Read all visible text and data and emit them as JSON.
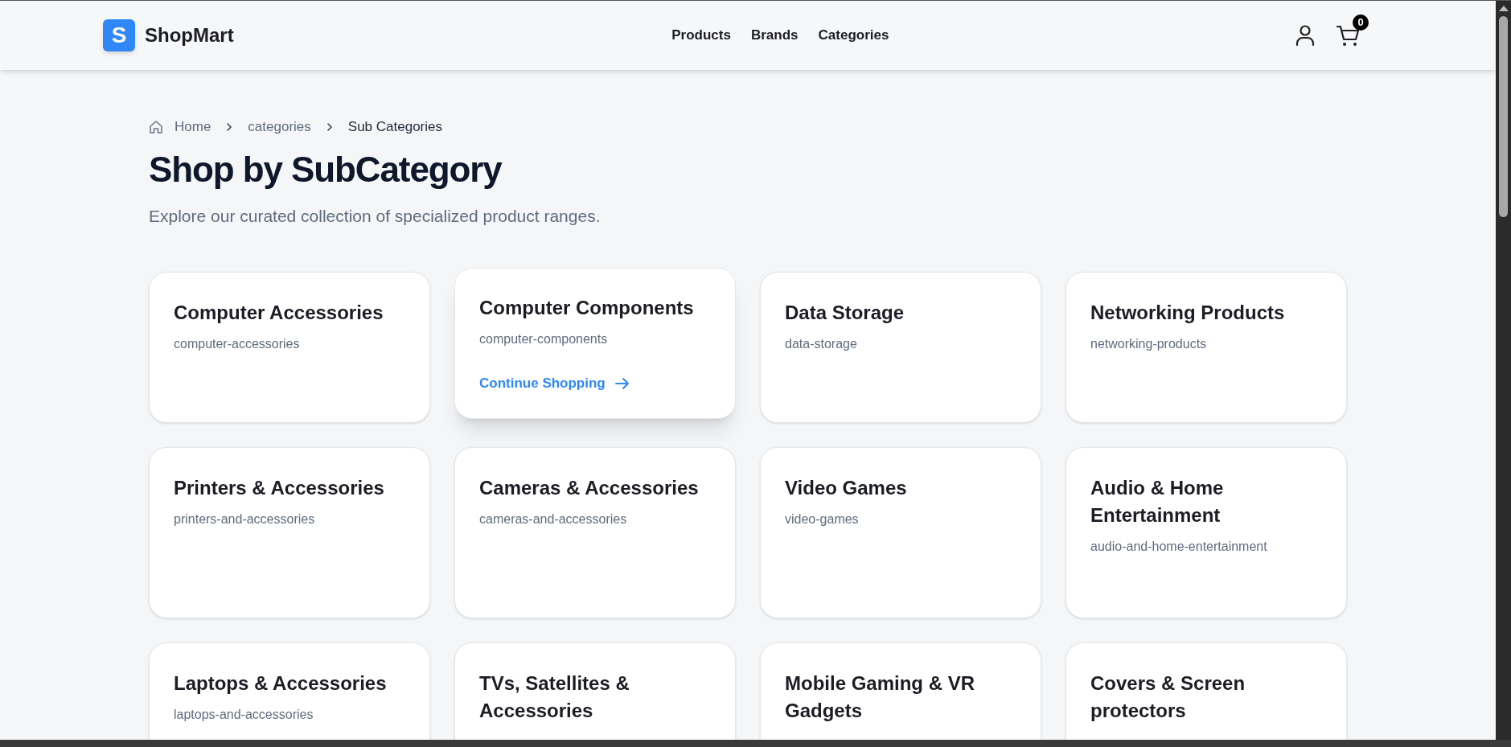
{
  "header": {
    "logo_letter": "S",
    "brand": "ShopMart",
    "nav": [
      {
        "label": "Products"
      },
      {
        "label": "Brands"
      },
      {
        "label": "Categories"
      }
    ],
    "cart_count": "0"
  },
  "breadcrumb": [
    {
      "label": "Home",
      "current": false
    },
    {
      "label": "categories",
      "current": false
    },
    {
      "label": "Sub Categories",
      "current": true
    }
  ],
  "title": "Shop by SubCategory",
  "subtitle": "Explore our curated collection of specialized product ranges.",
  "cards": [
    {
      "name": "Computer Accessories",
      "slug": "computer-accessories",
      "hovered": false
    },
    {
      "name": "Computer Components",
      "slug": "computer-components",
      "hovered": true,
      "link": "Continue Shopping"
    },
    {
      "name": "Data Storage",
      "slug": "data-storage",
      "hovered": false
    },
    {
      "name": "Networking Products",
      "slug": "networking-products",
      "hovered": false
    },
    {
      "name": "Printers & Accessories",
      "slug": "printers-and-accessories",
      "hovered": false
    },
    {
      "name": "Cameras & Accessories",
      "slug": "cameras-and-accessories",
      "hovered": false
    },
    {
      "name": "Video Games",
      "slug": "video-games",
      "hovered": false
    },
    {
      "name": "Audio & Home Entertainment",
      "slug": "audio-and-home-entertainment",
      "hovered": false
    },
    {
      "name": "Laptops & Accessories",
      "slug": "laptops-and-accessories",
      "hovered": false
    },
    {
      "name": "TVs, Satellites & Accessories",
      "hovered": false
    },
    {
      "name": "Mobile Gaming & VR Gadgets",
      "hovered": false
    },
    {
      "name": "Covers & Screen protectors",
      "hovered": false
    }
  ]
}
